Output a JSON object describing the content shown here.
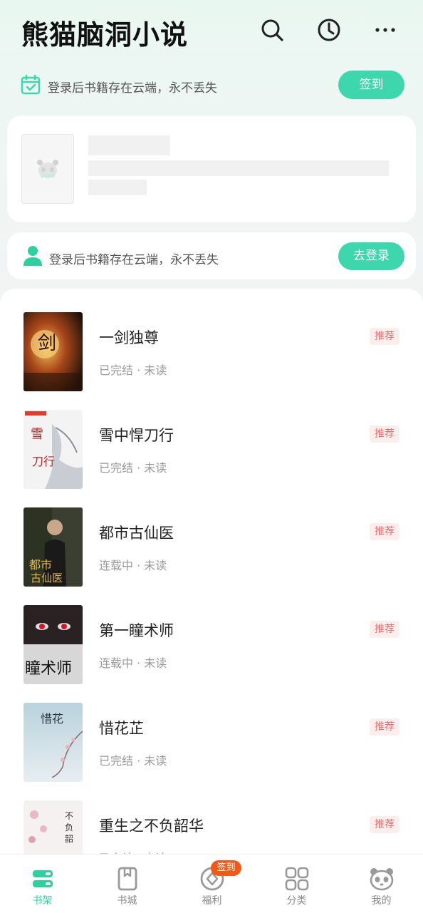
{
  "header": {
    "title": "熊猫脑洞小说",
    "icons": [
      "search-icon",
      "history-clock-icon",
      "more-icon"
    ]
  },
  "signin_bar": {
    "text": "登录后书籍存在云端，永不丢失",
    "button": "签到",
    "icon": "calendar-check-icon"
  },
  "login_card": {
    "text": "登录后书籍存在云端，永不丢失",
    "button": "去登录",
    "icon": "user-icon"
  },
  "books": [
    {
      "title": "一剑独尊",
      "status": "已完结 · 未读",
      "tag": "推荐"
    },
    {
      "title": "雪中悍刀行",
      "status": "已完结 · 未读",
      "tag": "推荐"
    },
    {
      "title": "都市古仙医",
      "status": "连载中 · 未读",
      "tag": "推荐"
    },
    {
      "title": "第一瞳术师",
      "status": "连载中 · 未读",
      "tag": "推荐"
    },
    {
      "title": "惜花芷",
      "status": "已完结 · 未读",
      "tag": "推荐"
    },
    {
      "title": "重生之不负韶华",
      "status": "已完结 · 未读",
      "tag": "推荐"
    }
  ],
  "tabs": [
    {
      "label": "书架",
      "icon": "bookshelf-icon",
      "active": true
    },
    {
      "label": "书城",
      "icon": "book-store-icon",
      "active": false
    },
    {
      "label": "福利",
      "icon": "coin-icon",
      "active": false,
      "badge": "签到"
    },
    {
      "label": "分类",
      "icon": "grid-icon",
      "active": false
    },
    {
      "label": "我的",
      "icon": "panda-icon",
      "active": false
    }
  ],
  "colors": {
    "accent": "#3dd6ad",
    "tab_active": "#2fcf9f",
    "tag_text": "#ef6b6b",
    "badge": "#f05a16"
  }
}
